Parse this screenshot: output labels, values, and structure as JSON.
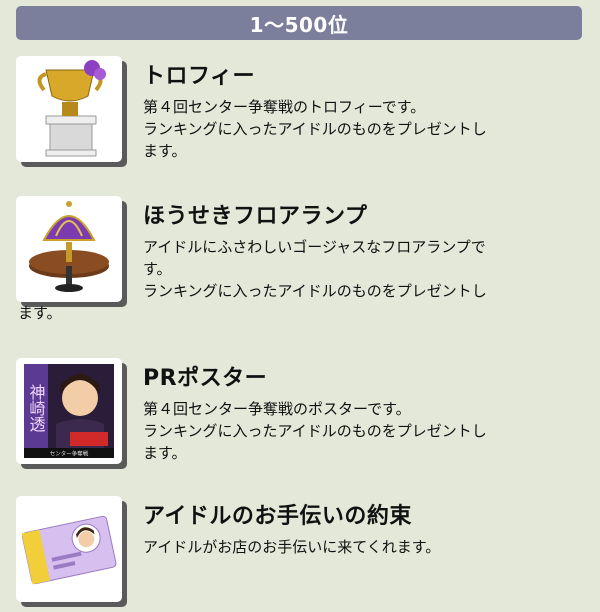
{
  "header": {
    "title": "1～500位"
  },
  "items": [
    {
      "title": "トロフィー",
      "lines": [
        "第４回センター争奪戦のトロフィーです。",
        "ランキングに入ったアイドルのものをプレゼントし",
        "ます。"
      ],
      "icon": "trophy-icon"
    },
    {
      "title": "ほうせきフロアランプ",
      "lines": [
        "アイドルにふさわしいゴージャスなフロアランプで",
        "す。",
        "ランキングに入ったアイドルのものをプレゼントし"
      ],
      "tail": "ます。",
      "icon": "floor-lamp-icon"
    },
    {
      "title": "PRポスター",
      "lines": [
        "第４回センター争奪戦のポスターです。",
        "ランキングに入ったアイドルのものをプレゼントし",
        "ます。"
      ],
      "icon": "poster-icon",
      "poster_text": {
        "name": "神崎透",
        "footer": "センター争奪戦"
      }
    },
    {
      "title": "アイドルのお手伝いの約束",
      "lines": [
        "アイドルがお店のお手伝いに来てくれます。"
      ],
      "icon": "ticket-icon"
    }
  ]
}
